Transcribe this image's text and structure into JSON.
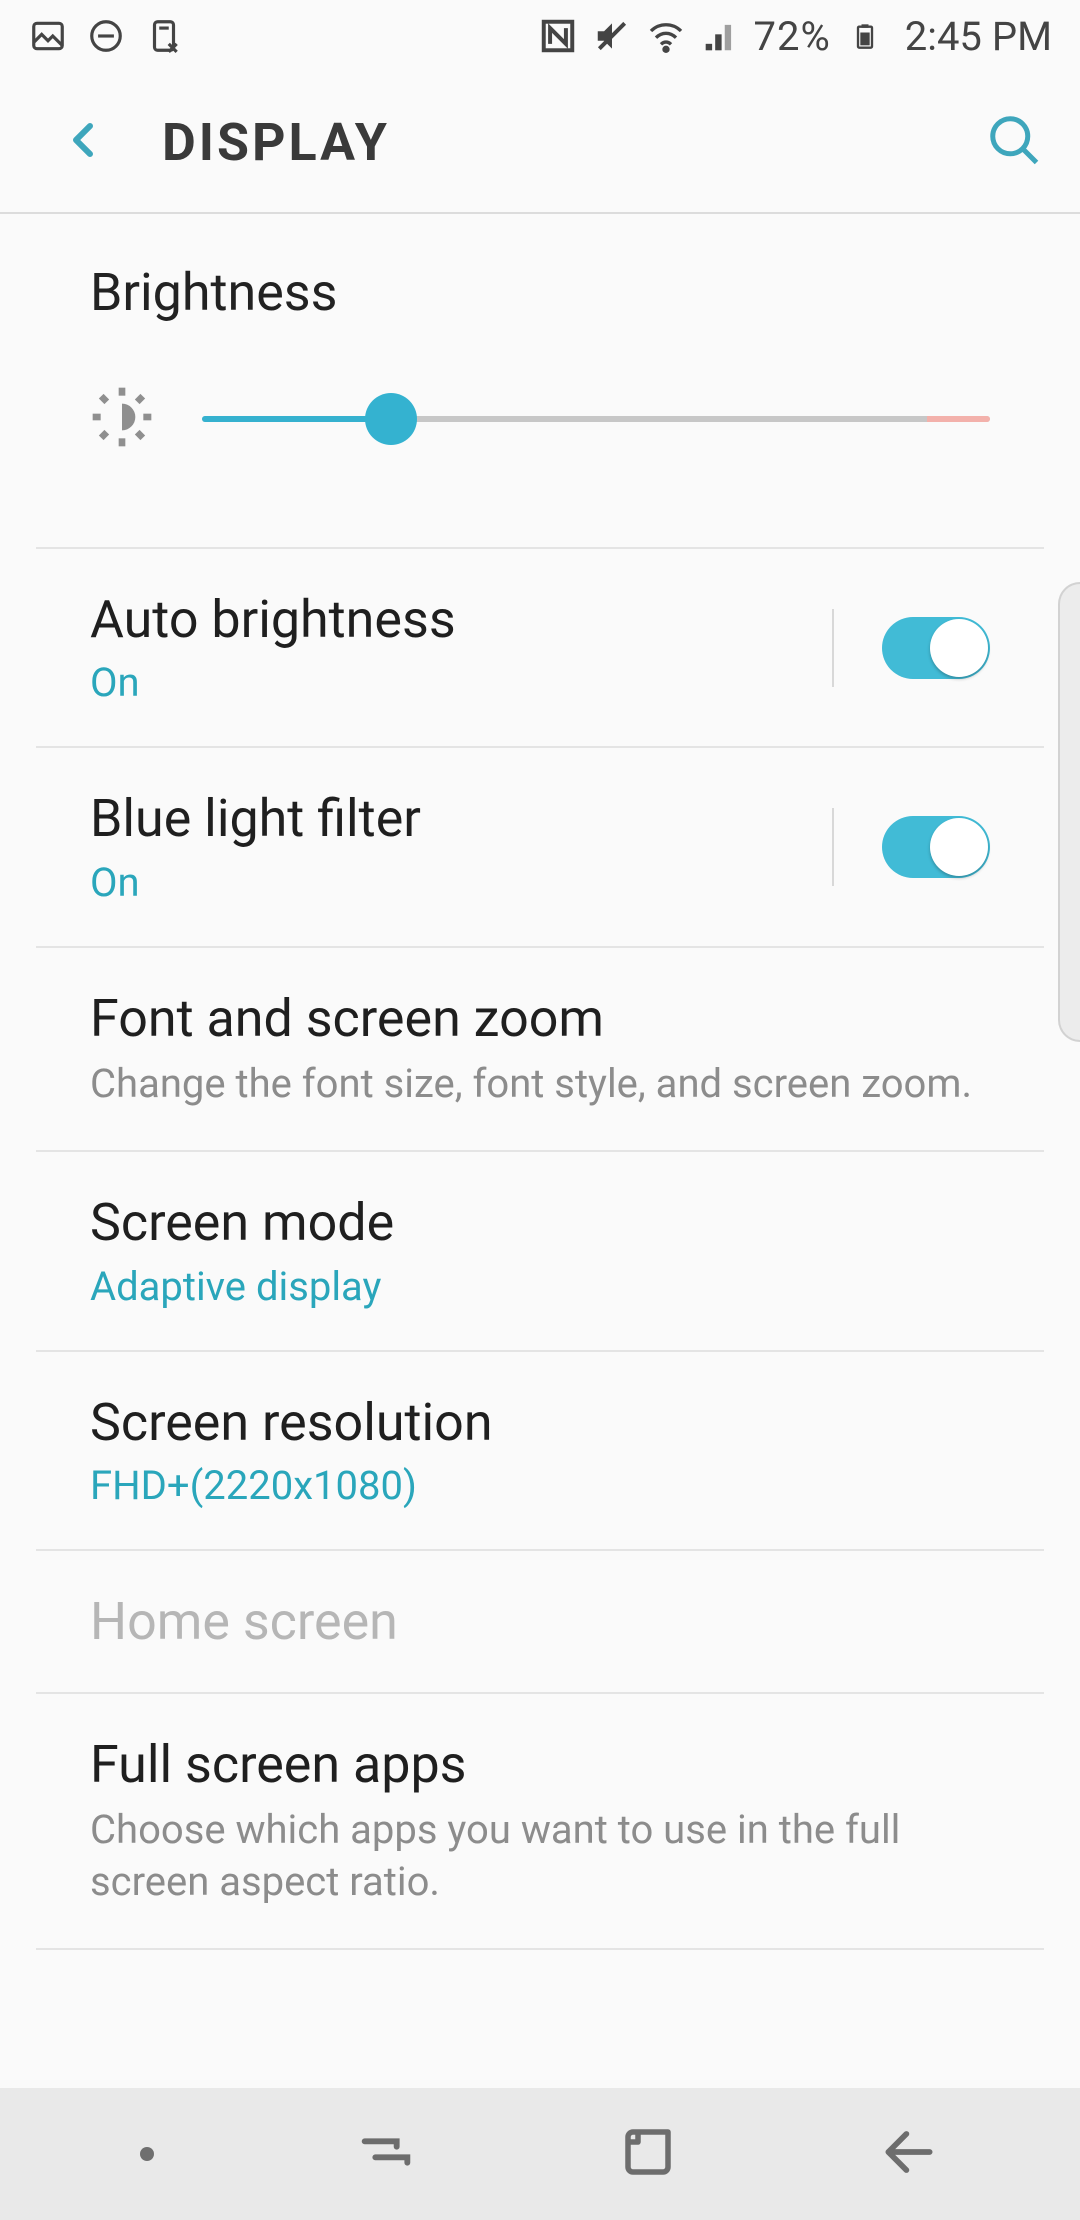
{
  "status": {
    "battery_pct": "72%",
    "time": "2:45 PM"
  },
  "header": {
    "title": "DISPLAY"
  },
  "brightness": {
    "title": "Brightness",
    "value_pct": 24
  },
  "rows": {
    "auto_brightness": {
      "title": "Auto brightness",
      "state": "On",
      "on": true
    },
    "blue_light": {
      "title": "Blue light filter",
      "state": "On",
      "on": true
    },
    "font_zoom": {
      "title": "Font and screen zoom",
      "sub": "Change the font size, font style, and screen zoom."
    },
    "screen_mode": {
      "title": "Screen mode",
      "value": "Adaptive display"
    },
    "screen_res": {
      "title": "Screen resolution",
      "value": "FHD+(2220x1080)"
    },
    "home_screen": {
      "title": "Home screen"
    },
    "full_screen": {
      "title": "Full screen apps",
      "sub": "Choose which apps you want to use in the full screen aspect ratio."
    }
  },
  "colors": {
    "accent": "#2aa6bb"
  }
}
